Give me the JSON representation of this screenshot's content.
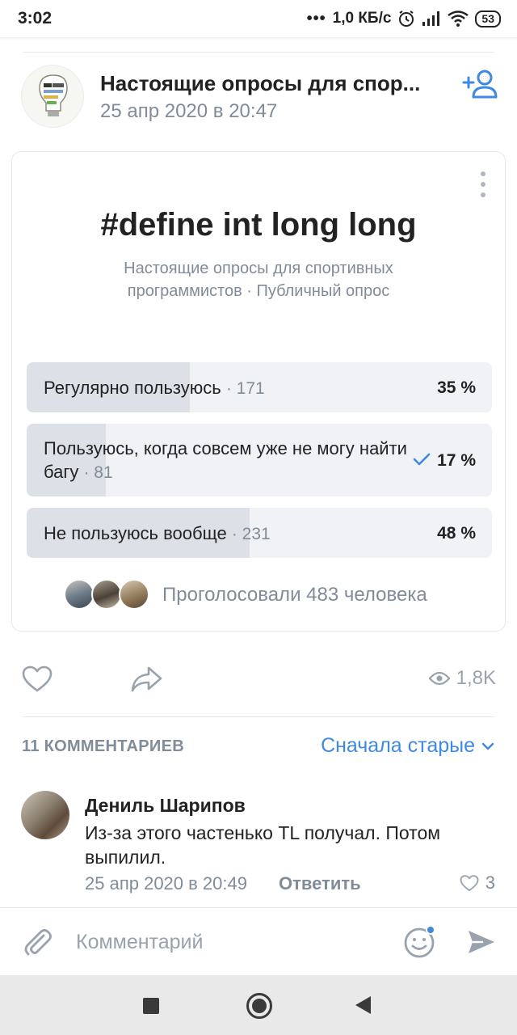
{
  "status_bar": {
    "time": "3:02",
    "speed": "1,0 КБ/с",
    "battery": "53"
  },
  "post": {
    "group_name": "Настоящие опросы для спор...",
    "date": "25 апр 2020 в 20:47"
  },
  "poll": {
    "title": "#define int long long",
    "subtitle": "Настоящие опросы для спортивных программистов · Публичный опрос",
    "options": [
      {
        "label": "Регулярно пользуюсь",
        "count": "· 171",
        "percent_text": "35 %",
        "percent": 35,
        "voted": false
      },
      {
        "label": "Пользуюсь, когда совсем уже не могу найти багу",
        "count": "· 81",
        "percent_text": "17 %",
        "percent": 17,
        "voted": true
      },
      {
        "label": "Не пользуюсь вообще",
        "count": "· 231",
        "percent_text": "48 %",
        "percent": 48,
        "voted": false
      }
    ],
    "voters_text": "Проголосовали 483 человека"
  },
  "actions": {
    "views": "1,8K"
  },
  "comments": {
    "count_label": "11 КОММЕНТАРИЕВ",
    "sort_label": "Сначала старые",
    "items": [
      {
        "author": "Дениль Шарипов",
        "text": "Из-за этого частенько TL получал. Потом выпилил.",
        "date": "25 апр 2020 в 20:49",
        "reply_label": "Ответить",
        "likes": "3"
      }
    ]
  },
  "input": {
    "placeholder": "Комментарий"
  },
  "colors": {
    "accent": "#3f8ae0",
    "secondary_text": "#818c99",
    "option_bg": "#f0f2f5",
    "option_fill": "#dde1e7"
  }
}
